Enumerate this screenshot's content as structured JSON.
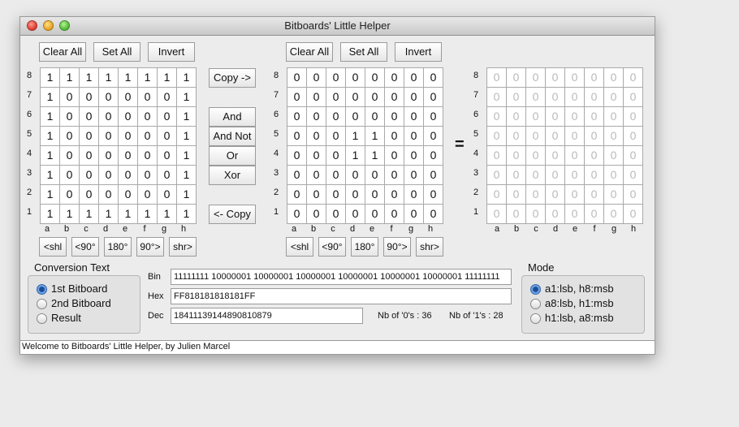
{
  "window": {
    "title": "Bitboards' Little Helper"
  },
  "board1": {
    "clear_all": "Clear All",
    "set_all": "Set All",
    "invert": "Invert",
    "rows": [
      [
        "1",
        "1",
        "1",
        "1",
        "1",
        "1",
        "1",
        "1"
      ],
      [
        "1",
        "0",
        "0",
        "0",
        "0",
        "0",
        "0",
        "1"
      ],
      [
        "1",
        "0",
        "0",
        "0",
        "0",
        "0",
        "0",
        "1"
      ],
      [
        "1",
        "0",
        "0",
        "0",
        "0",
        "0",
        "0",
        "1"
      ],
      [
        "1",
        "0",
        "0",
        "0",
        "0",
        "0",
        "0",
        "1"
      ],
      [
        "1",
        "0",
        "0",
        "0",
        "0",
        "0",
        "0",
        "1"
      ],
      [
        "1",
        "0",
        "0",
        "0",
        "0",
        "0",
        "0",
        "1"
      ],
      [
        "1",
        "1",
        "1",
        "1",
        "1",
        "1",
        "1",
        "1"
      ]
    ],
    "shift": [
      "<shl",
      "<90°",
      "180°",
      "90°>",
      "shr>"
    ]
  },
  "board2": {
    "clear_all": "Clear All",
    "set_all": "Set All",
    "invert": "Invert",
    "rows": [
      [
        "0",
        "0",
        "0",
        "0",
        "0",
        "0",
        "0",
        "0"
      ],
      [
        "0",
        "0",
        "0",
        "0",
        "0",
        "0",
        "0",
        "0"
      ],
      [
        "0",
        "0",
        "0",
        "0",
        "0",
        "0",
        "0",
        "0"
      ],
      [
        "0",
        "0",
        "0",
        "1",
        "1",
        "0",
        "0",
        "0"
      ],
      [
        "0",
        "0",
        "0",
        "1",
        "1",
        "0",
        "0",
        "0"
      ],
      [
        "0",
        "0",
        "0",
        "0",
        "0",
        "0",
        "0",
        "0"
      ],
      [
        "0",
        "0",
        "0",
        "0",
        "0",
        "0",
        "0",
        "0"
      ],
      [
        "0",
        "0",
        "0",
        "0",
        "0",
        "0",
        "0",
        "0"
      ]
    ],
    "shift": [
      "<shl",
      "<90°",
      "180°",
      "90°>",
      "shr>"
    ]
  },
  "result": {
    "equals": "=",
    "rows": [
      [
        "0",
        "0",
        "0",
        "0",
        "0",
        "0",
        "0",
        "0"
      ],
      [
        "0",
        "0",
        "0",
        "0",
        "0",
        "0",
        "0",
        "0"
      ],
      [
        "0",
        "0",
        "0",
        "0",
        "0",
        "0",
        "0",
        "0"
      ],
      [
        "0",
        "0",
        "0",
        "0",
        "0",
        "0",
        "0",
        "0"
      ],
      [
        "0",
        "0",
        "0",
        "0",
        "0",
        "0",
        "0",
        "0"
      ],
      [
        "0",
        "0",
        "0",
        "0",
        "0",
        "0",
        "0",
        "0"
      ],
      [
        "0",
        "0",
        "0",
        "0",
        "0",
        "0",
        "0",
        "0"
      ],
      [
        "0",
        "0",
        "0",
        "0",
        "0",
        "0",
        "0",
        "0"
      ]
    ]
  },
  "row_labels": [
    "8",
    "7",
    "6",
    "5",
    "4",
    "3",
    "2",
    "1"
  ],
  "col_labels": [
    "a",
    "b",
    "c",
    "d",
    "e",
    "f",
    "g",
    "h"
  ],
  "ops": {
    "copy_right": "Copy ->",
    "and": "And",
    "and_not": "And Not",
    "or": "Or",
    "xor": "Xor",
    "copy_left": "<- Copy"
  },
  "conversion": {
    "title": "Conversion Text",
    "options": [
      "1st Bitboard",
      "2nd Bitboard",
      "Result"
    ],
    "selected": 0,
    "bin_label": "Bin",
    "bin_value": "11111111 10000001 10000001 10000001 10000001 10000001 10000001 11111111",
    "hex_label": "Hex",
    "hex_value": "FF818181818181FF",
    "dec_label": "Dec",
    "dec_value": "18411139144890810879",
    "zeros": "Nb of '0's : 36",
    "ones": "Nb of '1's : 28"
  },
  "mode": {
    "title": "Mode",
    "options": [
      "a1:lsb, h8:msb",
      "a8:lsb, h1:msb",
      "h1:lsb, a8:msb"
    ],
    "selected": 0
  },
  "status": "Welcome to Bitboards' Little Helper, by Julien Marcel"
}
